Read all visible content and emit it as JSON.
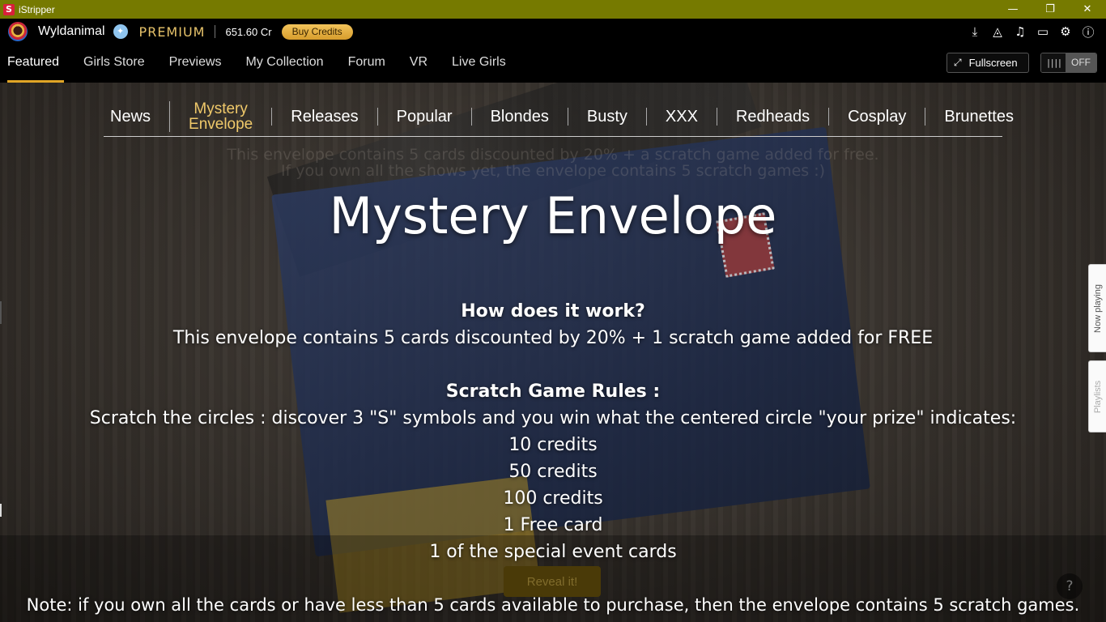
{
  "window": {
    "title": "iStripper",
    "app_logo": "S",
    "controls": {
      "minimize": "—",
      "restore": "❐",
      "close": "✕"
    }
  },
  "userbar": {
    "username": "Wyldanimal",
    "badge_glyph": "✦",
    "tier": "PREMIUM",
    "credits": "651.60 Cr",
    "buy_label": "Buy Credits",
    "icons": [
      {
        "name": "download-icon",
        "glyph": "⤓"
      },
      {
        "name": "megaphone-icon",
        "glyph": "◬"
      },
      {
        "name": "music-icon",
        "glyph": "♫"
      },
      {
        "name": "monitor-icon",
        "glyph": "▭"
      },
      {
        "name": "gear-icon",
        "glyph": "⚙"
      },
      {
        "name": "info-icon",
        "glyph": "ⓘ"
      }
    ]
  },
  "nav": {
    "items": [
      "Featured",
      "Girls Store",
      "Previews",
      "My Collection",
      "Forum",
      "VR",
      "Live Girls"
    ],
    "fullscreen_label": "Fullscreen",
    "fullscreen_glyph": "⤢",
    "toggle_grip": "||||",
    "toggle_state": "OFF"
  },
  "categories": {
    "items": [
      "News",
      "Mystery Envelope",
      "Releases",
      "Popular",
      "Blondes",
      "Busty",
      "XXX",
      "Redheads",
      "Cosplay",
      "Brunettes"
    ],
    "mystery_line1": "Mystery",
    "mystery_line2": "Envelope"
  },
  "ghost": {
    "line1": "This envelope contains 5 cards discounted by 20% + a scratch game added for free.",
    "line2": "If you own all the shows yet, the envelope contains 5 scratch games :)"
  },
  "main": {
    "title": "Mystery Envelope",
    "how_title": "How does it work?",
    "how_text": "This envelope contains 5 cards discounted by 20% + 1 scratch game added for FREE",
    "rules_title": "Scratch Game Rules :",
    "rules_text": "Scratch the circles : discover 3 \"S\" symbols and you win what the centered circle \"your prize\" indicates:",
    "prizes": [
      "10 credits",
      "50 credits",
      "100 credits",
      "1 Free card",
      "1 of the special event cards"
    ],
    "note": "Note: if you own all the cards or have less than 5 cards available to purchase, then the envelope contains 5 scratch games.",
    "reveal_label": "Reveal it!",
    "help_glyph": "?"
  },
  "side_tabs": {
    "now_playing": "Now playing",
    "playlists": "Playlists"
  }
}
